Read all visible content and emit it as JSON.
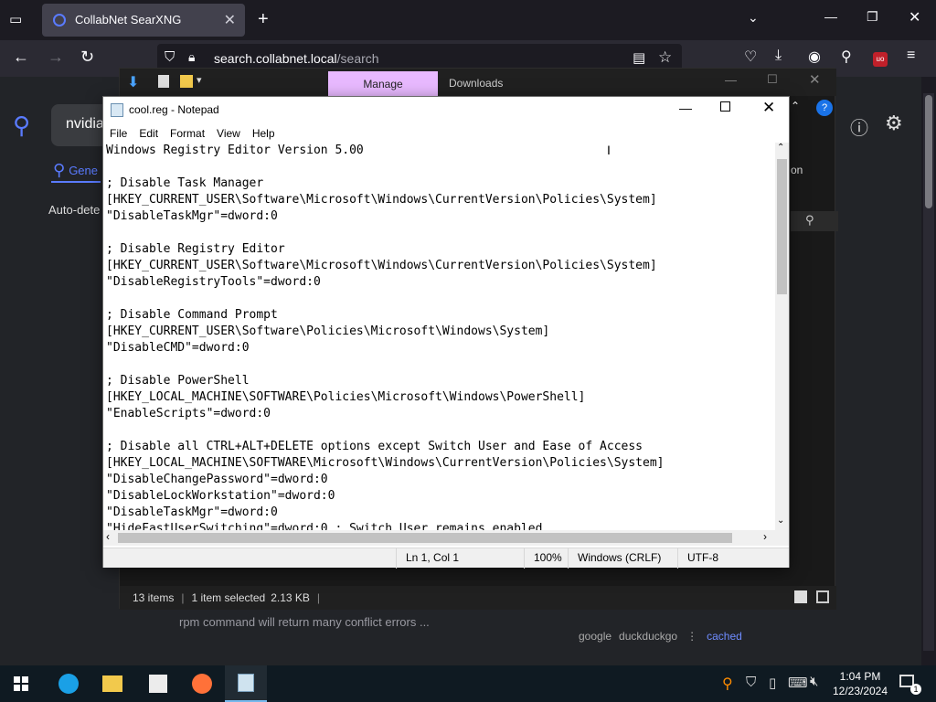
{
  "browser": {
    "tab_title": "CollabNet SearXNG",
    "url_host": "search.collabnet.local",
    "url_path": "/search"
  },
  "searxng": {
    "query_partial": "nvidia",
    "tab_general": "Gene",
    "auto_detect": "Auto-dete",
    "side_partial": "on",
    "snippet_line1": "... rpm command will return many conflict errors ...",
    "snippet_line2": "rpm command will return many conflict errors ...",
    "links": [
      "google",
      "duckduckgo",
      "cached"
    ]
  },
  "explorer": {
    "ribbon_manage": "Manage",
    "ribbon_downloads": "Downloads",
    "status_items": "13 items",
    "status_selected": "1 item selected",
    "status_size": "2.13 KB"
  },
  "notepad": {
    "title": "cool.reg - Notepad",
    "menu": [
      "File",
      "Edit",
      "Format",
      "View",
      "Help"
    ],
    "lines": [
      "Windows Registry Editor Version 5.00",
      "",
      "; Disable Task Manager",
      "[HKEY_CURRENT_USER\\Software\\Microsoft\\Windows\\CurrentVersion\\Policies\\System]",
      "\"DisableTaskMgr\"=dword:0",
      "",
      "; Disable Registry Editor",
      "[HKEY_CURRENT_USER\\Software\\Microsoft\\Windows\\CurrentVersion\\Policies\\System]",
      "\"DisableRegistryTools\"=dword:0",
      "",
      "; Disable Command Prompt",
      "[HKEY_CURRENT_USER\\Software\\Policies\\Microsoft\\Windows\\System]",
      "\"DisableCMD\"=dword:0",
      "",
      "; Disable PowerShell",
      "[HKEY_LOCAL_MACHINE\\SOFTWARE\\Policies\\Microsoft\\Windows\\PowerShell]",
      "\"EnableScripts\"=dword:0",
      "",
      "; Disable all CTRL+ALT+DELETE options except Switch User and Ease of Access",
      "[HKEY_LOCAL_MACHINE\\SOFTWARE\\Microsoft\\Windows\\CurrentVersion\\Policies\\System]",
      "\"DisableChangePassword\"=dword:0",
      "\"DisableLockWorkstation\"=dword:0",
      "\"DisableTaskMgr\"=dword:0",
      "\"HideFastUserSwitching\"=dword:0 ; Switch User remains enabled"
    ],
    "status": {
      "position": "Ln 1, Col 1",
      "zoom": "100%",
      "line_ending": "Windows (CRLF)",
      "encoding": "UTF-8"
    }
  },
  "taskbar": {
    "time": "1:04 PM",
    "date": "12/23/2024",
    "notification_count": "1"
  },
  "colors": {
    "manage_tab": "#e8b9ff",
    "taskbar": "#0f1a22",
    "searx_accent": "#5a7bff"
  }
}
